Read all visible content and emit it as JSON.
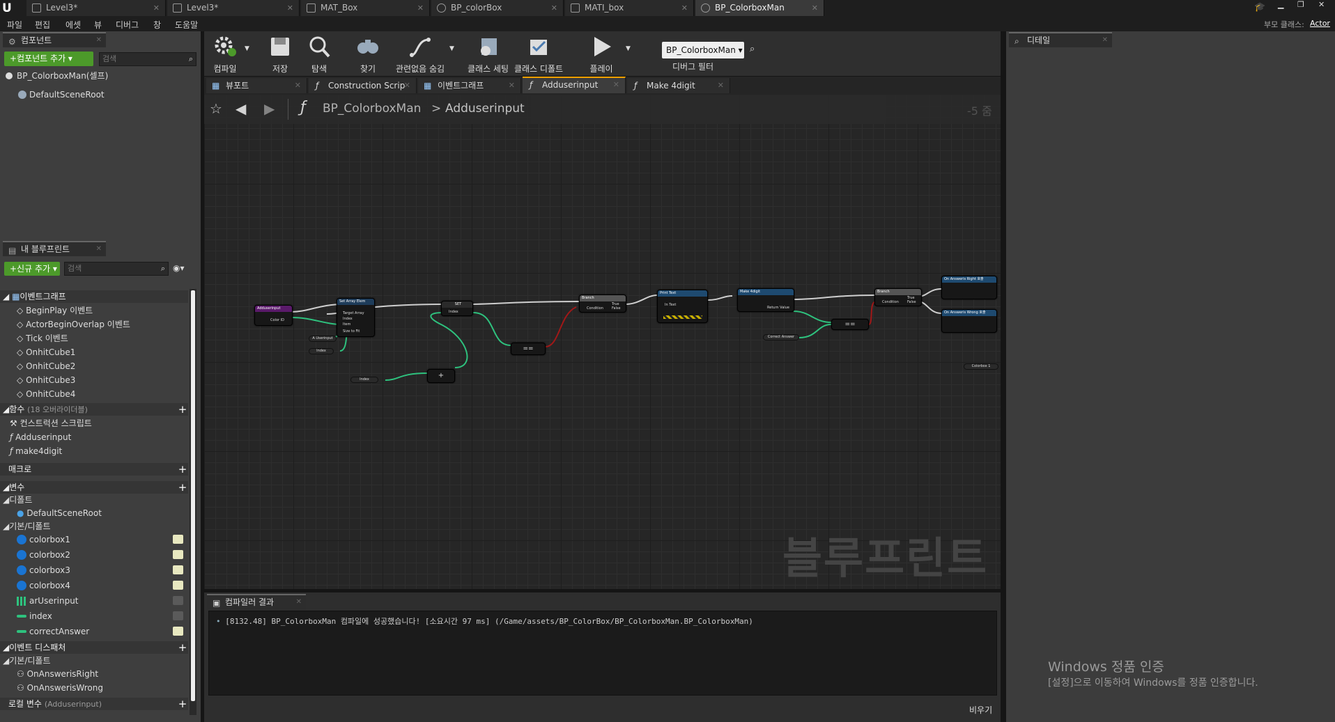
{
  "tabs": [
    {
      "label": "Level3*",
      "active": false
    },
    {
      "label": "Level3*",
      "active": false
    },
    {
      "label": "MAT_Box",
      "active": false
    },
    {
      "label": "BP_colorBox",
      "active": false
    },
    {
      "label": "MATI_box",
      "active": false
    },
    {
      "label": "BP_ColorboxMan",
      "active": true
    }
  ],
  "menu": [
    "파일",
    "편집",
    "에셋",
    "뷰",
    "디버그",
    "창",
    "도움말"
  ],
  "parent_class": {
    "label": "부모 클래스:",
    "value": "Actor"
  },
  "components": {
    "tab_label": "컴포넌트",
    "add_button": "+컴포넌트 추가 ▾",
    "search_placeholder": "검색",
    "self_item": "BP_ColorboxMan(셀프)",
    "root_item": "DefaultSceneRoot"
  },
  "my_blueprint": {
    "tab_label": "내 블루프린트",
    "add_button": "+신규 추가 ▾",
    "search_placeholder": "검색",
    "event_graph_header": "이벤트그래프",
    "events": [
      "BeginPlay 이벤트",
      "ActorBeginOverlap 이벤트",
      "Tick 이벤트",
      "OnhitCube1",
      "OnhitCube2",
      "OnhitCube3",
      "OnhitCube4"
    ],
    "functions_header": "함수",
    "functions_note": "(18 오버라이더블)",
    "functions": [
      "컨스트럭션 스크립트",
      "Adduserinput",
      "make4digit"
    ],
    "macros_header": "매크로",
    "variables_header": "변수",
    "default_group": "디폴트",
    "default_vars": [
      "DefaultSceneRoot"
    ],
    "basic_group": "기본/디폴트",
    "vars": [
      {
        "name": "colorbox1",
        "color": "#1a74d2",
        "visible": true
      },
      {
        "name": "colorbox2",
        "color": "#1a74d2",
        "visible": true
      },
      {
        "name": "colorbox3",
        "color": "#1a74d2",
        "visible": true
      },
      {
        "name": "colorbox4",
        "color": "#1a74d2",
        "visible": true
      },
      {
        "name": "arUserinput",
        "color": "#2ec27e",
        "visible": false
      },
      {
        "name": "index",
        "color": "#2ec27e",
        "visible": false
      },
      {
        "name": "correctAnswer",
        "color": "#2ec27e",
        "visible": true
      }
    ],
    "dispatchers_header": "이벤트 디스패처",
    "dispatcher_group": "기본/디폴트",
    "dispatchers": [
      "OnAnswerisRight",
      "OnAnswerisWrong"
    ],
    "local_vars_header": "로컬 변수",
    "local_vars_note": "(Adduserinput)"
  },
  "toolbar": {
    "compile": "컴파일",
    "save": "저장",
    "browse": "탐색",
    "find": "찾기",
    "hide_unrelated": "관련없음 숨김",
    "class_settings": "클래스 세팅",
    "class_defaults": "클래스 디폴트",
    "play": "플레이",
    "debug_object": "BP_ColorboxMan ▾",
    "debug_filter": "디버그 필터"
  },
  "doc_tabs": [
    {
      "label": "뷰포트",
      "active": false
    },
    {
      "label": "Construction Scrip",
      "active": false
    },
    {
      "label": "이벤트그래프",
      "active": false
    },
    {
      "label": "Adduserinput",
      "active": true
    },
    {
      "label": "Make 4digit",
      "active": false
    }
  ],
  "breadcrumb": {
    "root": "BP_ColorboxMan",
    "sep": ">",
    "current": "Adduserinput",
    "zoom": "-5 줌"
  },
  "graph_watermark": "블루프린트",
  "nodes": {
    "entry": {
      "title": "Adduserinput",
      "pin": "Color ID"
    },
    "set_array": {
      "title": "Set Array Elem",
      "pins": [
        "Target Array",
        "Index",
        "Item",
        "Size to Fit"
      ]
    },
    "get_userinput": "A Userinput",
    "get_index1": "Index",
    "get_index2": "Index",
    "set_node": {
      "title": "SET",
      "pin": "Index"
    },
    "plus_node": "+",
    "equal_node": "==",
    "branch1": {
      "title": "Branch",
      "pins": [
        "Condition",
        "True",
        "False"
      ]
    },
    "print": {
      "title": "Print Text",
      "pin": "In Text"
    },
    "make4": {
      "title": "Make 4digit",
      "pin": "Return Value"
    },
    "correct": "Correct Answer",
    "equal2": "==",
    "branch2": {
      "title": "Branch",
      "pins": [
        "Condition",
        "True",
        "False"
      ]
    },
    "right_call": "On Answeris Right 호출",
    "wrong_call": "On Answeris Wrong 호출",
    "colorbox_ref": "Colorbox 1"
  },
  "output": {
    "tab_label": "컴파일러 결과",
    "log": "[8132.48] BP_ColorboxMan 컴파일에 성공했습니다! [소요시간 97 ms] (/Game/assets/BP_ColorBox/BP_ColorboxMan.BP_ColorboxMan)",
    "clear": "비우기"
  },
  "details": {
    "tab_label": "디테일"
  },
  "activation": {
    "title": "Windows 정품 인증",
    "subtitle": "[설정]으로 이동하여 Windows를 정품 인증합니다."
  }
}
